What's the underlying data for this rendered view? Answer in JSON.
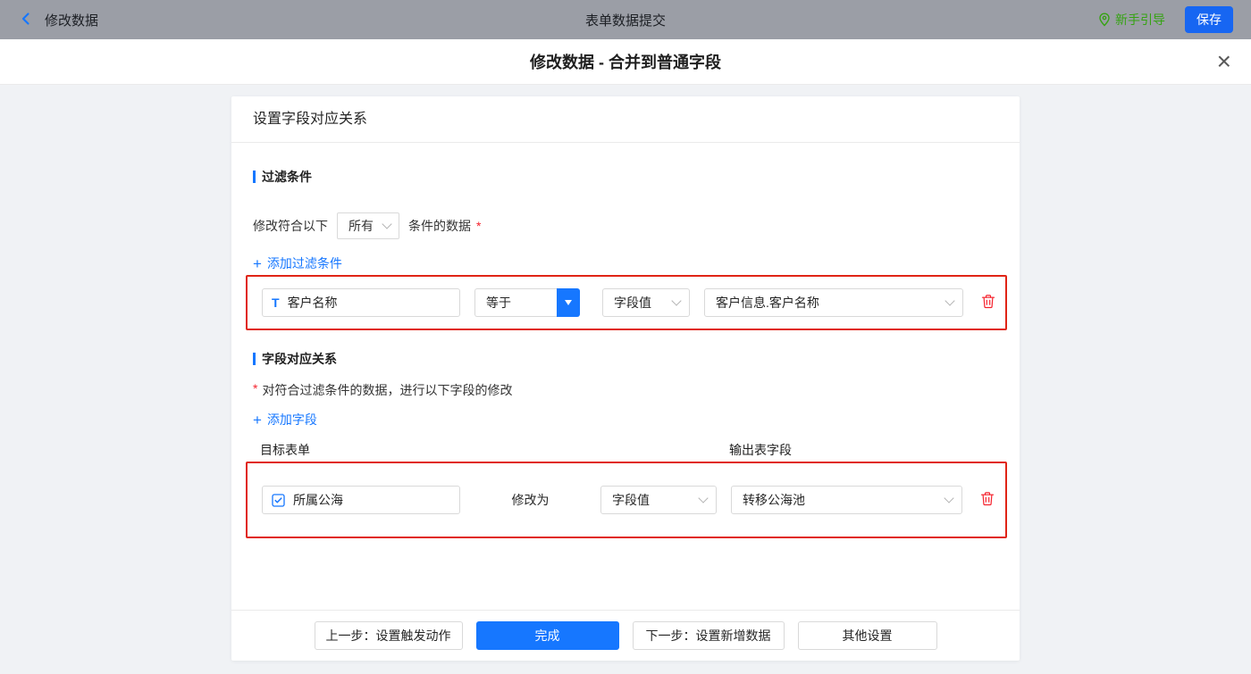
{
  "topbar": {
    "back_label": "修改数据",
    "title": "表单数据提交",
    "guide_label": "新手引导",
    "save_label": "保存"
  },
  "dialog": {
    "title": "修改数据 - 合并到普通字段"
  },
  "panel": {
    "header_title": "设置字段对应关系"
  },
  "filter_section": {
    "title": "过滤条件",
    "condition_prefix": "修改符合以下",
    "match_mode": "所有",
    "condition_suffix": "条件的数据",
    "required_mark": "*",
    "add_label": "添加过滤条件",
    "row": {
      "field_name": "客户名称",
      "operator": "等于",
      "value_type": "字段值",
      "value": "客户信息.客户名称"
    }
  },
  "mapping_section": {
    "title": "字段对应关系",
    "required_mark": "*",
    "description": "对符合过滤条件的数据，进行以下字段的修改",
    "add_label": "添加字段",
    "column_target": "目标表单",
    "column_output": "输出表字段",
    "row": {
      "field_name": "所属公海",
      "action_label": "修改为",
      "value_type": "字段值",
      "value": "转移公海池"
    }
  },
  "footer": {
    "prev_label": "上一步：设置触发动作",
    "done_label": "完成",
    "next_label": "下一步：设置新增数据",
    "other_label": "其他设置"
  },
  "icons": {
    "back": "chevron-left",
    "guide": "location-pin",
    "close_glyph": "×",
    "plus_glyph": "+",
    "text_field_glyph": "T",
    "field_checkbox": "checkbox-check",
    "select_caret": "chevron-down",
    "operator_caret": "triangle-down",
    "delete": "trash"
  },
  "colors": {
    "accent_blue": "#1677ff",
    "guide_green": "#35a312",
    "danger_red": "#f5222d",
    "annotation_red": "#e02416",
    "topbar_bg": "#9b9ea6"
  }
}
